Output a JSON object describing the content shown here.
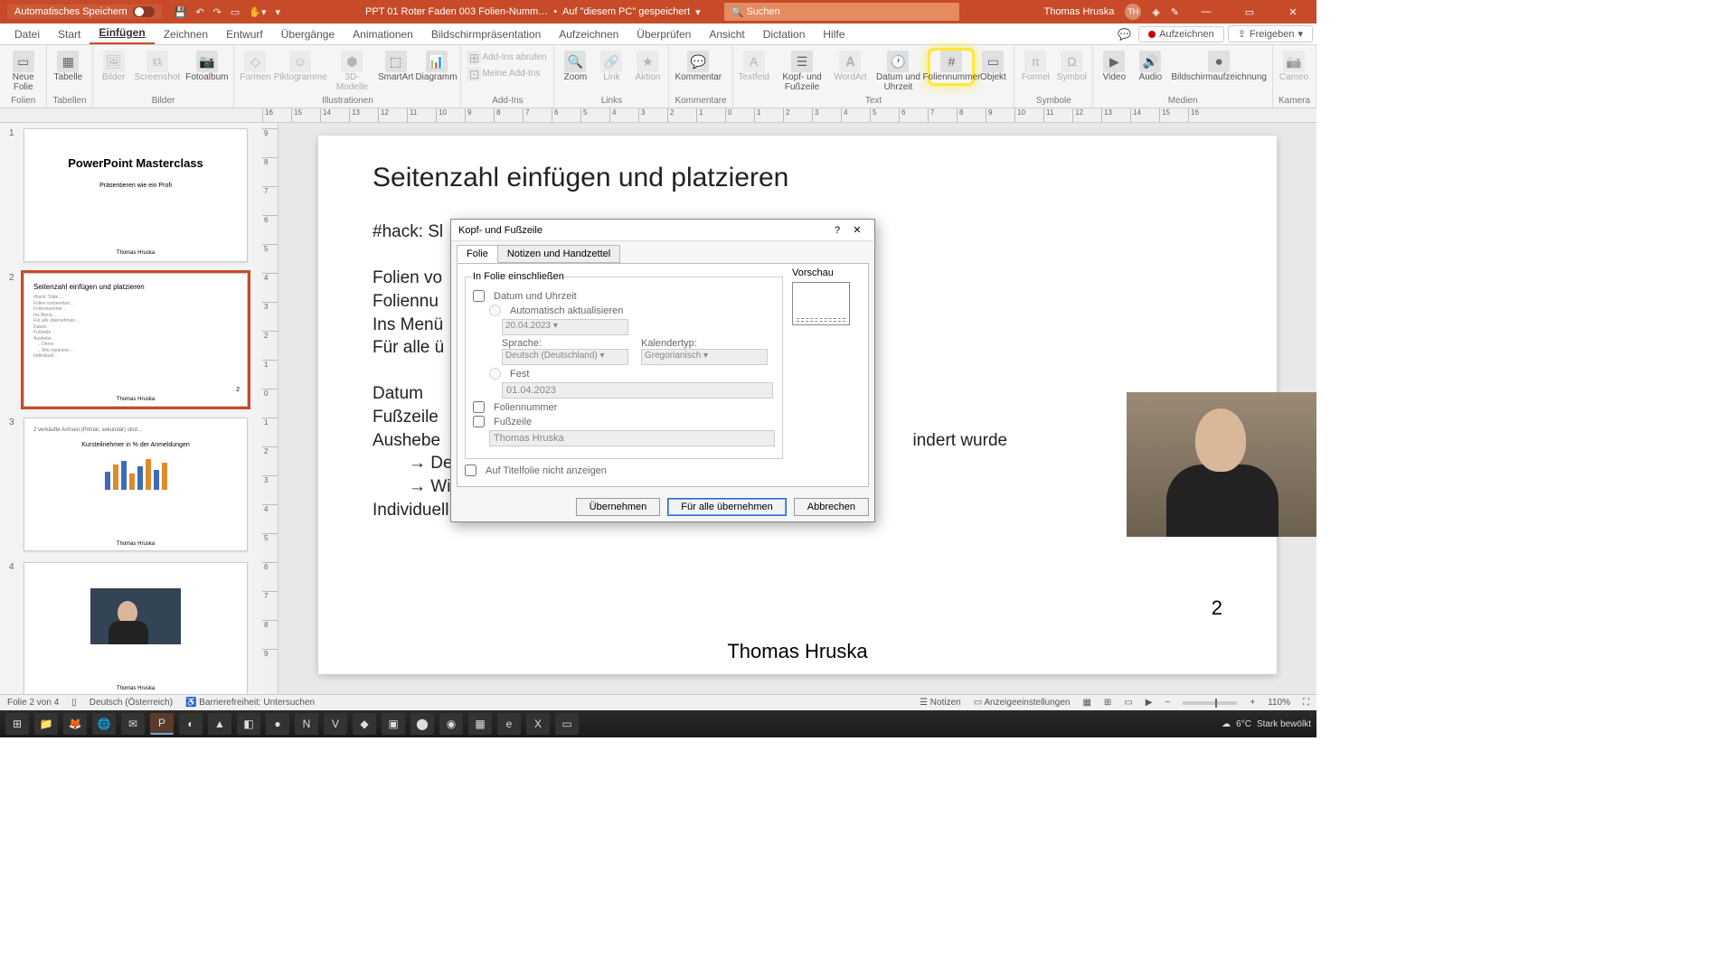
{
  "titlebar": {
    "autosave": "Automatisches Speichern",
    "filename": "PPT 01 Roter Faden 003 Folien-Numm…",
    "saved_hint": "Auf \"diesem PC\" gespeichert",
    "search_placeholder": "Suchen",
    "user_name": "Thomas Hruska",
    "user_initials": "TH"
  },
  "ribbon_tabs": {
    "items": [
      "Datei",
      "Start",
      "Einfügen",
      "Zeichnen",
      "Entwurf",
      "Übergänge",
      "Animationen",
      "Bildschirmpräsentation",
      "Aufzeichnen",
      "Überprüfen",
      "Ansicht",
      "Dictation",
      "Hilfe"
    ],
    "active_index": 2,
    "record": "Aufzeichnen",
    "share": "Freigeben"
  },
  "ribbon_groups": {
    "folien": {
      "label": "Folien",
      "new_slide": "Neue\nFolie"
    },
    "tabellen": {
      "label": "Tabellen",
      "tabelle": "Tabelle"
    },
    "bilder": {
      "label": "Bilder",
      "items": [
        "Bilder",
        "Screenshot",
        "Fotoalbum"
      ]
    },
    "illustr": {
      "label": "Illustrationen",
      "items": [
        "Formen",
        "Piktogramme",
        "3D-\nModelle",
        "SmartArt",
        "Diagramm"
      ]
    },
    "addins": {
      "label": "Add-Ins",
      "get": "Add-Ins abrufen",
      "my": "Meine Add-Ins"
    },
    "links": {
      "label": "Links",
      "items": [
        "Zoom",
        "Link",
        "Aktion"
      ]
    },
    "kommentar": {
      "label": "Kommentare",
      "item": "Kommentar"
    },
    "text": {
      "label": "Text",
      "items": [
        "Textfeld",
        "Kopf- und\nFußzeile",
        "WordArt",
        "Datum und\nUhrzeit",
        "Foliennummer",
        "Objekt"
      ]
    },
    "symbole": {
      "label": "Symbole",
      "items": [
        "Formel",
        "Symbol"
      ]
    },
    "medien": {
      "label": "Medien",
      "items": [
        "Video",
        "Audio",
        "Bildschirmaufzeichnung"
      ]
    },
    "kamera": {
      "label": "Kamera",
      "item": "Cameo"
    }
  },
  "thumbs": {
    "items": [
      {
        "title": "PowerPoint Masterclass",
        "subtitle": "Präsentieren wie ein Profi",
        "author": "Thomas Hruska"
      },
      {
        "title": "Seitenzahl einfügen und platzieren",
        "author": "Thomas Hruska",
        "active": true
      },
      {
        "title": "Kursteilnehmer in % der Anmeldungen",
        "author": "Thomas Hruska"
      },
      {
        "title": "",
        "author": "Thomas Hruska"
      }
    ]
  },
  "slide": {
    "title": "Seitenzahl einfügen und platzieren",
    "hack": "#hack: Sl",
    "line1": "Folien vo",
    "line2": "Foliennu",
    "line3": "Ins Menü",
    "line4": "Für alle ü",
    "line5": "Datum",
    "line6": "Fußzeile",
    "line7_tail": "indert wurde",
    "line7_pre": "Aushebe",
    "demo": "Demo",
    "fix": "Wie repariere ich das?",
    "line8": "Individuell gestalten im Folienmaster/Layout",
    "page": "2",
    "author": "Thomas Hruska"
  },
  "dialog": {
    "title": "Kopf- und Fußzeile",
    "help": "?",
    "tabs": [
      "Folie",
      "Notizen und Handzettel"
    ],
    "active_tab": 0,
    "include_label": "In Folie einschließen",
    "preview_label": "Vorschau",
    "date_chk": "Datum und Uhrzeit",
    "auto_radio": "Automatisch aktualisieren",
    "date_val": "20.04.2023",
    "lang_label": "Sprache:",
    "lang_val": "Deutsch (Deutschland)",
    "cal_label": "Kalendertyp:",
    "cal_val": "Gregorianisch",
    "fixed_radio": "Fest",
    "fixed_val": "01.04.2023",
    "slidenum_chk": "Foliennummer",
    "footer_chk": "Fußzeile",
    "footer_val": "Thomas Hruska",
    "notitle_chk": "Auf Titelfolie nicht anzeigen",
    "apply": "Übernehmen",
    "apply_all": "Für alle übernehmen",
    "cancel": "Abbrechen"
  },
  "status": {
    "slide_pos": "Folie 2 von 4",
    "lang": "Deutsch (Österreich)",
    "access": "Barrierefreiheit: Untersuchen",
    "notes": "Notizen",
    "display": "Anzeigeeinstellungen",
    "zoom": "110%"
  },
  "taskbar": {
    "weather_temp": "6°C",
    "weather_text": "Stark bewölkt"
  },
  "ruler_h": [
    "16",
    "15",
    "14",
    "13",
    "12",
    "11",
    "10",
    "9",
    "8",
    "7",
    "6",
    "5",
    "4",
    "3",
    "2",
    "1",
    "0",
    "1",
    "2",
    "3",
    "4",
    "5",
    "6",
    "7",
    "8",
    "9",
    "10",
    "11",
    "12",
    "13",
    "14",
    "15",
    "16"
  ],
  "ruler_v": [
    "9",
    "8",
    "7",
    "6",
    "5",
    "4",
    "3",
    "2",
    "1",
    "0",
    "1",
    "2",
    "3",
    "4",
    "5",
    "6",
    "7",
    "8",
    "9"
  ]
}
